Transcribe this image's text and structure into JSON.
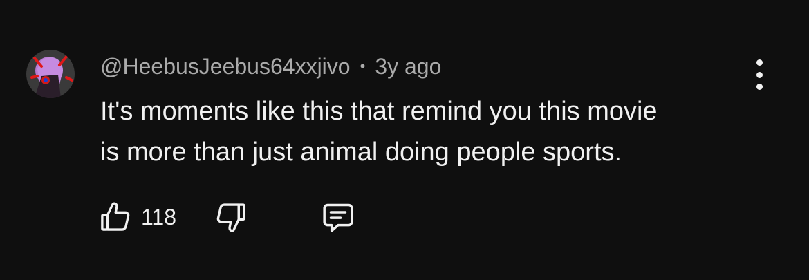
{
  "comment": {
    "author": "@HeebusJeebus64xxjivo",
    "separator": "•",
    "time": "3y ago",
    "text_lines": [
      "It's moments like this that remind you this movie",
      "is more than just animal doing people sports."
    ],
    "likes": "118"
  },
  "icons": {
    "avatar": "avatar-image",
    "like": "thumbs-up-icon",
    "dislike": "thumbs-down-icon",
    "reply": "comment-reply-icon",
    "more": "vertical-dots-icon"
  },
  "colors": {
    "background": "#0f0f0f",
    "primary_text": "#f1f1f1",
    "secondary_text": "#aaaaaa"
  }
}
